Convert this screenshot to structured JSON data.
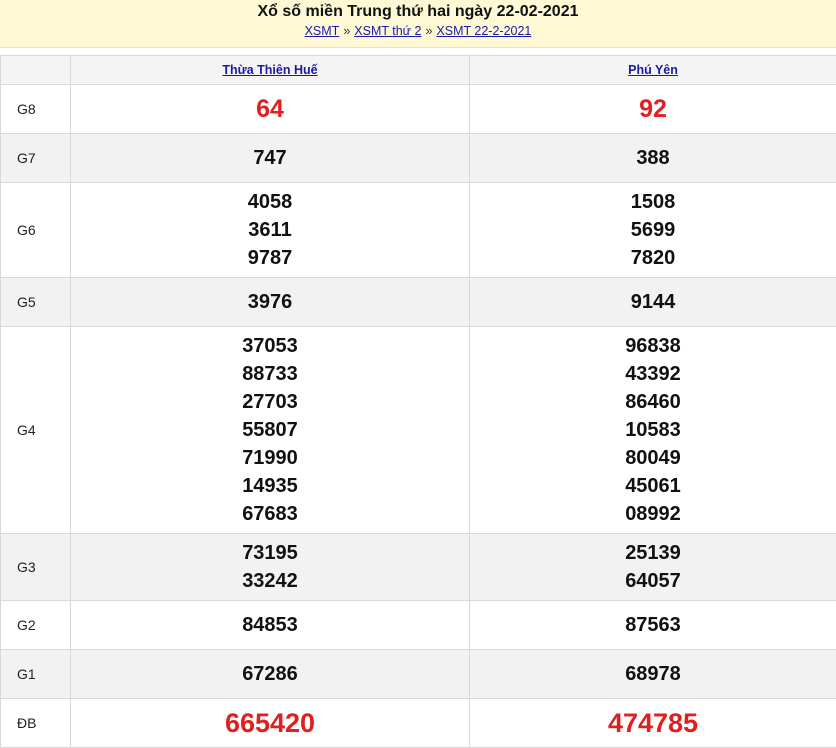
{
  "header": {
    "title": "Xổ số miền Trung thứ hai ngày 22-02-2021",
    "breadcrumbs": [
      "XSMT",
      "XSMT thứ 2",
      "XSMT 22-2-2021"
    ],
    "separator": "»"
  },
  "table": {
    "provinces": [
      "Thừa Thiên Huế",
      "Phú Yên"
    ],
    "rows": [
      {
        "label": "G8",
        "col1": [
          "64"
        ],
        "col2": [
          "92"
        ]
      },
      {
        "label": "G7",
        "col1": [
          "747"
        ],
        "col2": [
          "388"
        ]
      },
      {
        "label": "G6",
        "col1": [
          "4058",
          "3611",
          "9787"
        ],
        "col2": [
          "1508",
          "5699",
          "7820"
        ]
      },
      {
        "label": "G5",
        "col1": [
          "3976"
        ],
        "col2": [
          "9144"
        ]
      },
      {
        "label": "G4",
        "col1": [
          "37053",
          "88733",
          "27703",
          "55807",
          "71990",
          "14935",
          "67683"
        ],
        "col2": [
          "96838",
          "43392",
          "86460",
          "10583",
          "80049",
          "45061",
          "08992"
        ]
      },
      {
        "label": "G3",
        "col1": [
          "73195",
          "33242"
        ],
        "col2": [
          "25139",
          "64057"
        ]
      },
      {
        "label": "G2",
        "col1": [
          "84853"
        ],
        "col2": [
          "87563"
        ]
      },
      {
        "label": "G1",
        "col1": [
          "67286"
        ],
        "col2": [
          "68978"
        ]
      },
      {
        "label": "ĐB",
        "col1": [
          "665420"
        ],
        "col2": [
          "474785"
        ]
      }
    ]
  },
  "colors": {
    "header_bg": "#fff8d4",
    "highlight_red": "#e02020",
    "link": "#1a1aa6",
    "alt_row": "#f2f2f2"
  }
}
